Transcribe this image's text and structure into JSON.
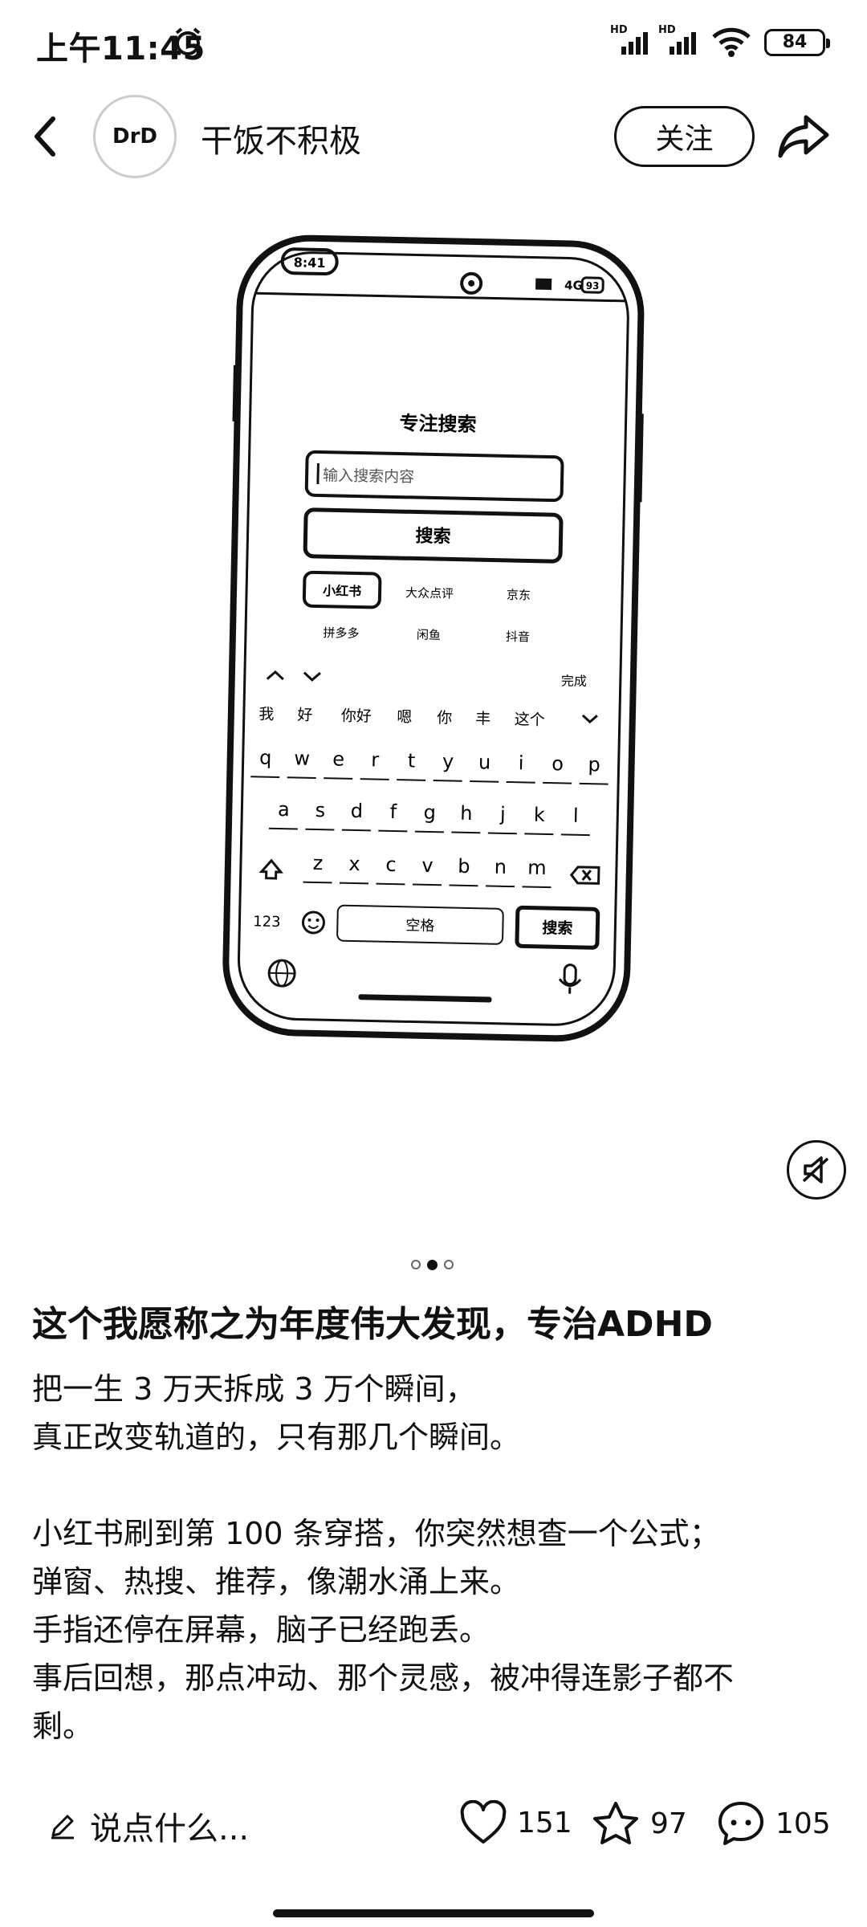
{
  "status_bar": {
    "time": "上午11:45",
    "signal1_label": "HD",
    "signal2_label": "HD",
    "battery": "84"
  },
  "header": {
    "author": "干饭不积极",
    "avatar_text": "DrD",
    "follow_label": "关注"
  },
  "photo": {
    "mock_status_time": "8:41",
    "mock_network": "4G",
    "mock_battery": "93",
    "app_title": "专注搜索",
    "search_placeholder": "输入搜索内容",
    "search_button": "搜索",
    "platforms": [
      "小红书",
      "大众点评",
      "京东",
      "拼多多",
      "闲鱼",
      "抖音"
    ],
    "selected_platform": "小红书",
    "toolbar_done": "完成",
    "candidates": [
      "我",
      "好",
      "你好",
      "嗯",
      "你",
      "丰",
      "这个"
    ],
    "keys_row1": [
      "q",
      "w",
      "e",
      "r",
      "t",
      "y",
      "u",
      "i",
      "o",
      "p"
    ],
    "keys_row2": [
      "a",
      "s",
      "d",
      "f",
      "g",
      "h",
      "j",
      "k",
      "l"
    ],
    "keys_row3": [
      "z",
      "x",
      "c",
      "v",
      "b",
      "n",
      "m"
    ],
    "key_123": "123",
    "key_space": "空格",
    "key_search": "搜索"
  },
  "carousel": {
    "count": 3,
    "active": 1
  },
  "post": {
    "title": "这个我愿称之为年度伟大发现，专治ADHD",
    "lines": [
      "把一生 3 万天拆成 3 万个瞬间，",
      "真正改变轨道的，只有那几个瞬间。",
      "",
      "小红书刷到第 100 条穿搭，你突然想查一个公式；",
      "弹窗、热搜、推荐，像潮水涌上来。",
      "手指还停在屏幕，脑子已经跑丢。",
      "事后回想，那点冲动、那个灵感，被冲得连影子都不",
      "剩。"
    ]
  },
  "bottom_bar": {
    "comment_placeholder": "说点什么...",
    "likes": "151",
    "collects": "97",
    "comments": "105"
  }
}
